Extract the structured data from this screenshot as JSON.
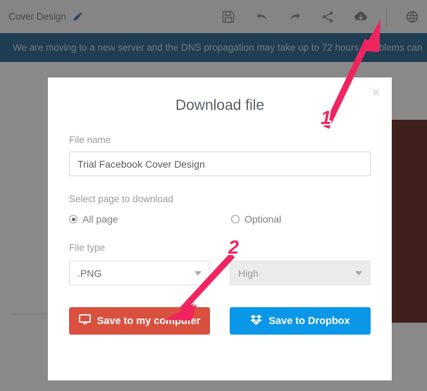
{
  "toolbar": {
    "document_title": "Cover Design",
    "edit_icon": "pencil-icon",
    "actions": [
      {
        "name": "save-icon",
        "label": "Save"
      },
      {
        "name": "undo-icon",
        "label": "Undo"
      },
      {
        "name": "redo-icon",
        "label": "Redo"
      },
      {
        "name": "share-icon",
        "label": "Share"
      },
      {
        "name": "download-cloud-icon",
        "label": "Download"
      },
      {
        "name": "globe-icon",
        "label": "Language"
      }
    ]
  },
  "banner": {
    "message": "We are moving to a new server and the DNS propagation may take up to 72 hours. Problems can",
    "background_color": "#145a8a"
  },
  "dialog": {
    "title": "Download file",
    "close_label": "×",
    "filename": {
      "label": "File name",
      "value": "Trial Facebook Cover Design",
      "placeholder": "File name"
    },
    "page_select": {
      "label": "Select page to download",
      "options": [
        {
          "label": "All page",
          "selected": true
        },
        {
          "label": "Optional",
          "selected": false
        }
      ]
    },
    "filetype": {
      "label": "File type",
      "format_value": ".PNG",
      "quality_value": "High",
      "quality_disabled": true
    },
    "buttons": {
      "save_computer": {
        "label": "Save to my computer",
        "icon": "monitor-icon",
        "color": "#d9503f"
      },
      "save_dropbox": {
        "label": "Save to Dropbox",
        "icon": "dropbox-icon",
        "color": "#0b97e8"
      }
    }
  },
  "annotations": {
    "color": "#f0245f",
    "steps": [
      {
        "number": "1",
        "target": "download-cloud-icon"
      },
      {
        "number": "2",
        "target": "save-computer-button"
      }
    ]
  },
  "canvas": {
    "design_background_color": "#5d1710",
    "motif_color": "#73261c"
  }
}
